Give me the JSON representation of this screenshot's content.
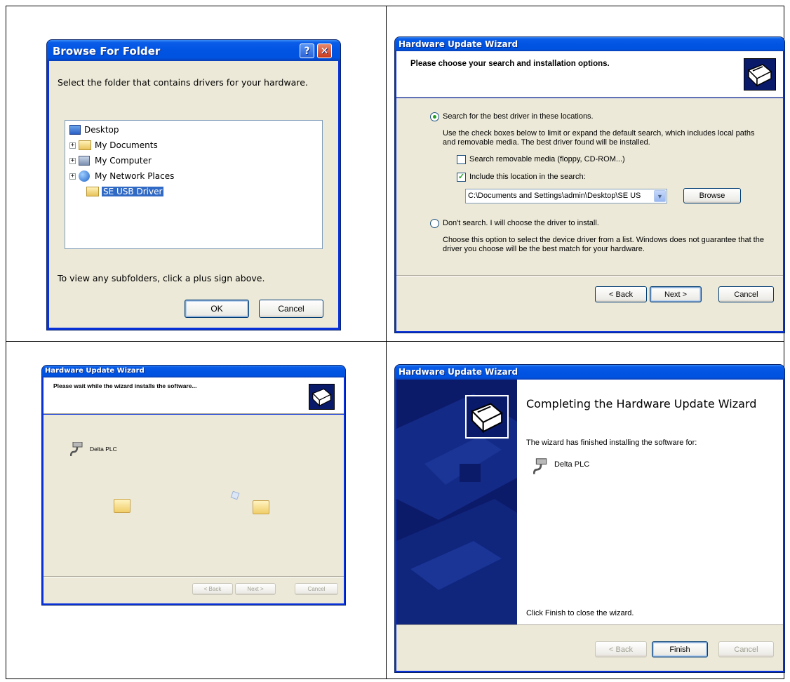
{
  "browse": {
    "title": "Browse For Folder",
    "help_icon": "help-icon",
    "close_icon": "close-icon",
    "instruction": "Select the folder that contains drivers for your hardware.",
    "tree": [
      {
        "label": "Desktop",
        "icon": "desktop-icon",
        "expandable": false,
        "selected": false
      },
      {
        "label": "My Documents",
        "icon": "folder-icon",
        "expandable": true,
        "selected": false
      },
      {
        "label": "My Computer",
        "icon": "computer-icon",
        "expandable": true,
        "selected": false
      },
      {
        "label": "My Network Places",
        "icon": "network-icon",
        "expandable": true,
        "selected": false
      },
      {
        "label": "SE USB Driver",
        "icon": "folder-open-icon",
        "expandable": false,
        "selected": true
      }
    ],
    "hint": "To view any subfolders, click a plus sign above.",
    "ok_label": "OK",
    "cancel_label": "Cancel"
  },
  "search_options": {
    "title": "Hardware Update Wizard",
    "heading": "Please choose your search and installation options.",
    "radio_search": "Search for the best driver in these locations.",
    "search_desc": "Use the check boxes below to limit or expand the default search, which includes local paths and removable media. The best driver found will be installed.",
    "check_removable": "Search removable media (floppy, CD-ROM...)",
    "check_removable_checked": false,
    "check_location": "Include this location in the search:",
    "check_location_checked": true,
    "location_value": "C:\\Documents and Settings\\admin\\Desktop\\SE US",
    "browse_label": "Browse",
    "radio_dont": "Don't search. I will choose the driver to install.",
    "dont_desc": "Choose this option to select the device driver from a list.  Windows does not guarantee that the driver you choose will be the best match for your hardware.",
    "back_label": "< Back",
    "next_label": "Next >",
    "cancel_label": "Cancel"
  },
  "installing": {
    "title": "Hardware Update Wizard",
    "heading": "Please wait while the wizard installs the software...",
    "device": "Delta PLC",
    "back_label": "< Back",
    "next_label": "Next >",
    "cancel_label": "Cancel"
  },
  "completing": {
    "title": "Hardware Update Wizard",
    "heading": "Completing the Hardware Update Wizard",
    "finished_text": "The wizard has finished installing the software for:",
    "device": "Delta PLC",
    "close_hint": "Click Finish to close the wizard.",
    "back_label": "< Back",
    "finish_label": "Finish",
    "cancel_label": "Cancel"
  }
}
